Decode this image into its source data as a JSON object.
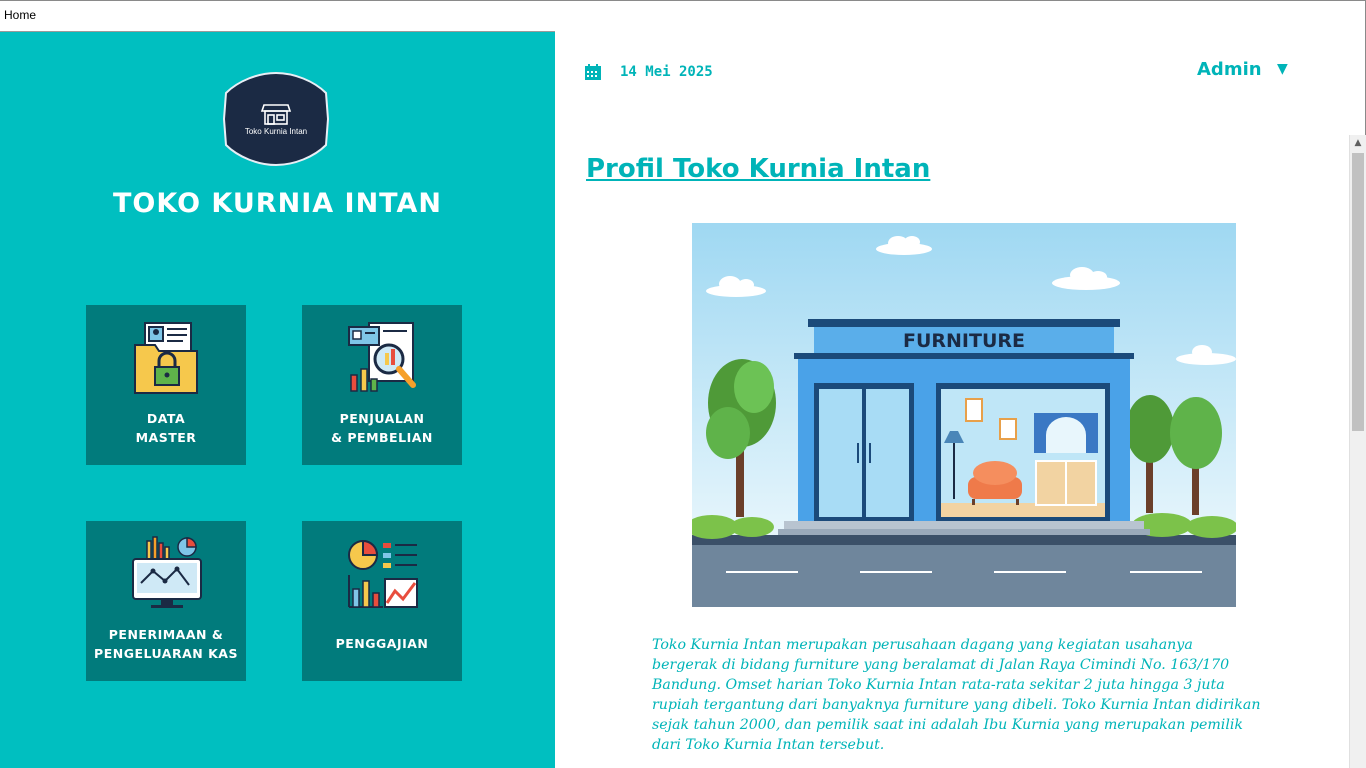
{
  "window": {
    "tab_title": "Home"
  },
  "sidebar": {
    "logo_text": "Toko Kurnia Intan",
    "brand_title": "TOKO KURNIA INTAN",
    "menu": [
      {
        "line1": "DATA",
        "line2": "MASTER",
        "icon": "folder-lock-icon"
      },
      {
        "line1": "PENJUALAN",
        "line2": "& PEMBELIAN",
        "icon": "report-magnifier-icon"
      },
      {
        "line1": "PENERIMAAN &",
        "line2": "PENGELUARAN KAS",
        "icon": "monitor-chart-icon"
      },
      {
        "line1": "PENGGAJIAN",
        "line2": "",
        "icon": "pie-bar-chart-icon"
      }
    ]
  },
  "header": {
    "date": "14 Mei 2025",
    "user": "Admin",
    "caret": "▼"
  },
  "main": {
    "title": "Profil Toko Kurnia Intan",
    "store_sign": "FURNITURE",
    "description": "Toko Kurnia Intan merupakan perusahaan dagang yang kegiatan usahanya bergerak di bidang furniture yang beralamat di Jalan Raya Cimindi No. 163/170 Bandung. Omset harian Toko Kurnia Intan rata-rata sekitar 2 juta hingga 3 juta rupiah tergantung dari banyaknya furniture yang dibeli. Toko Kurnia Intan didirikan sejak tahun 2000, dan pemilik saat ini adalah Ibu Kurnia yang merupakan pemilik dari Toko Kurnia Intan tersebut."
  },
  "colors": {
    "sidebar_bg": "#00bfc0",
    "tile_bg": "#017b7c",
    "accent": "#00b4b8"
  }
}
